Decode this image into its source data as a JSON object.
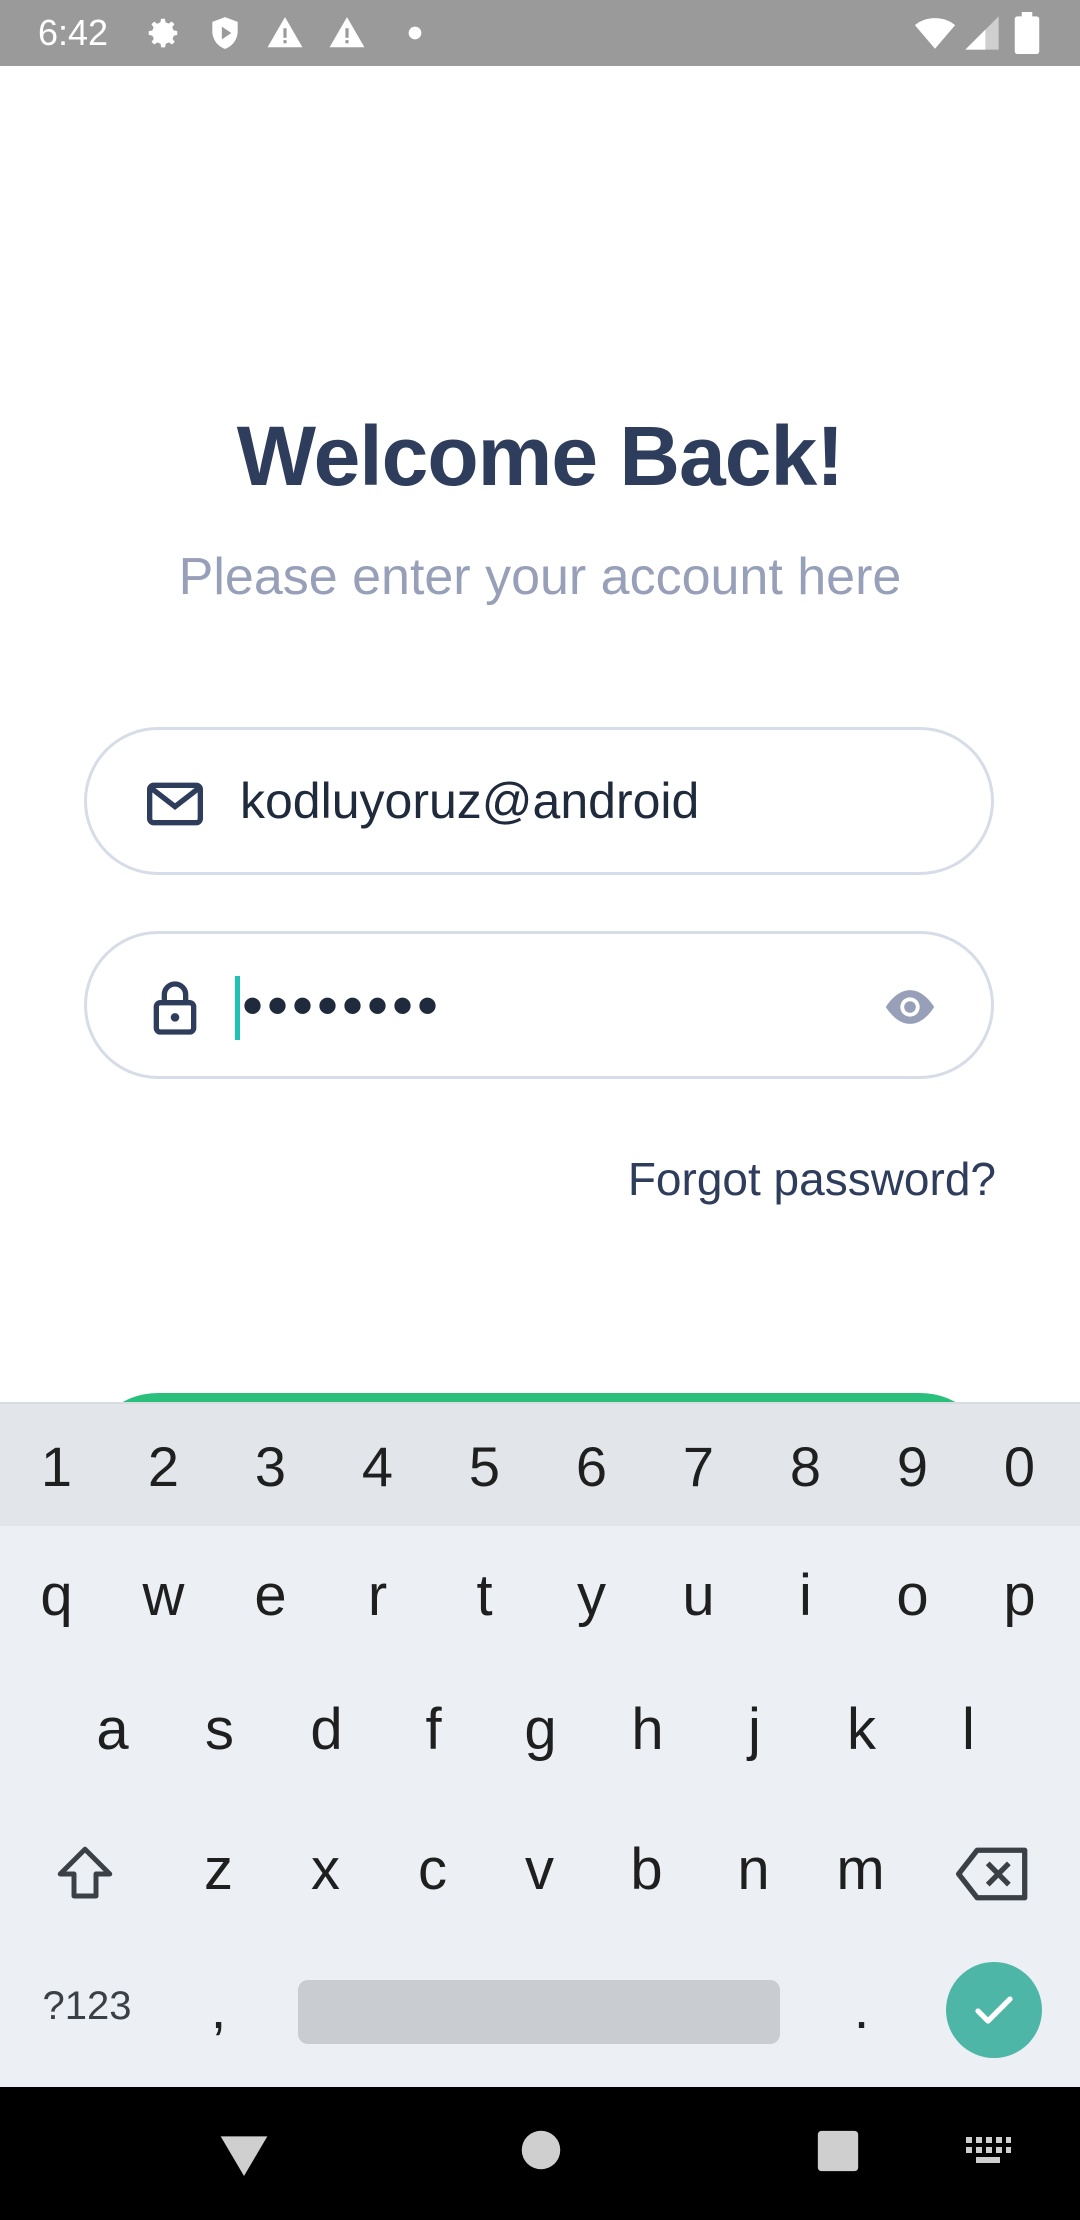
{
  "status_bar": {
    "time": "6:42",
    "left_icons": [
      "gear-icon",
      "shield-icon",
      "warning-icon",
      "warning-icon",
      "dot-icon"
    ],
    "right_icons": [
      "wifi-icon",
      "signal-icon",
      "battery-icon"
    ]
  },
  "screen": {
    "title": "Welcome Back!",
    "subtitle": "Please enter your account here",
    "email_field": {
      "value": "kodluyoruz@android",
      "icon": "mail-icon"
    },
    "password_field": {
      "masked_value": "••••••••",
      "icon": "lock-icon",
      "toggle_icon": "eye-icon"
    },
    "forgot_password": "Forgot password?",
    "colors": {
      "title": "#2f3d5c",
      "subtitle": "#97a0b8",
      "accent": "#2bbf7c",
      "caret": "#22c1b6"
    }
  },
  "keyboard": {
    "number_row": [
      "1",
      "2",
      "3",
      "4",
      "5",
      "6",
      "7",
      "8",
      "9",
      "0"
    ],
    "row1": [
      "q",
      "w",
      "e",
      "r",
      "t",
      "y",
      "u",
      "i",
      "o",
      "p"
    ],
    "row2": [
      "a",
      "s",
      "d",
      "f",
      "g",
      "h",
      "j",
      "k",
      "l"
    ],
    "row3": [
      "z",
      "x",
      "c",
      "v",
      "b",
      "n",
      "m"
    ],
    "symbols_key": "?123",
    "comma_key": ",",
    "period_key": ".",
    "shift_icon": "shift-icon",
    "backspace_icon": "backspace-icon",
    "enter_icon": "check-icon",
    "enter_color": "#4db6a6"
  },
  "nav_bar": {
    "icons": [
      "back-icon",
      "home-icon",
      "recents-icon",
      "keyboard-switch-icon"
    ]
  }
}
